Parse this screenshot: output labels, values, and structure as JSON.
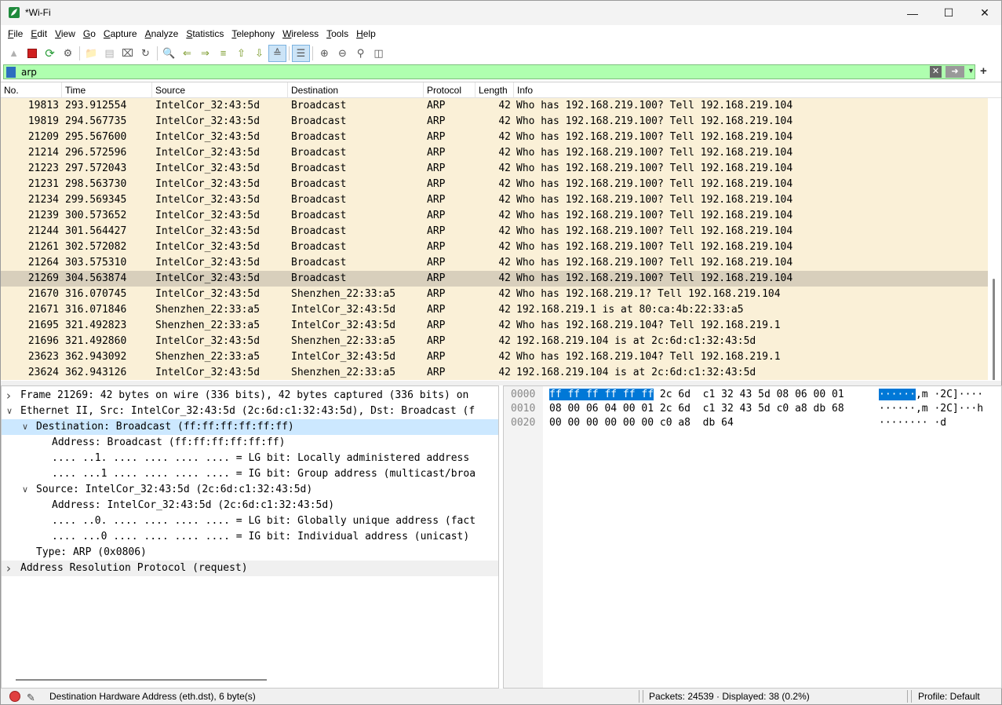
{
  "window": {
    "title": "*Wi-Fi"
  },
  "menu": [
    "File",
    "Edit",
    "View",
    "Go",
    "Capture",
    "Analyze",
    "Statistics",
    "Telephony",
    "Wireless",
    "Tools",
    "Help"
  ],
  "toolbar_icons": [
    "shark-fin-start-icon",
    "stop-capture-icon",
    "restart-capture-icon",
    "capture-options-icon",
    "open-file-icon",
    "save-file-icon",
    "close-file-icon",
    "reload-icon",
    "find-icon",
    "go-back-icon",
    "go-forward-icon",
    "go-to-packet-icon",
    "first-packet-icon",
    "last-packet-icon",
    "autoscroll-icon",
    "colorize-icon",
    "zoom-in-icon",
    "zoom-out-icon",
    "normal-size-icon",
    "resize-columns-icon"
  ],
  "filter": {
    "value": "arp"
  },
  "columns": [
    "No.",
    "Time",
    "Source",
    "Destination",
    "Protocol",
    "Length",
    "Info"
  ],
  "packets": [
    {
      "no": "19813",
      "time": "293.912554",
      "src": "IntelCor_32:43:5d",
      "dst": "Broadcast",
      "proto": "ARP",
      "len": "42",
      "info": "Who has 192.168.219.100? Tell 192.168.219.104"
    },
    {
      "no": "19819",
      "time": "294.567735",
      "src": "IntelCor_32:43:5d",
      "dst": "Broadcast",
      "proto": "ARP",
      "len": "42",
      "info": "Who has 192.168.219.100? Tell 192.168.219.104"
    },
    {
      "no": "21209",
      "time": "295.567600",
      "src": "IntelCor_32:43:5d",
      "dst": "Broadcast",
      "proto": "ARP",
      "len": "42",
      "info": "Who has 192.168.219.100? Tell 192.168.219.104"
    },
    {
      "no": "21214",
      "time": "296.572596",
      "src": "IntelCor_32:43:5d",
      "dst": "Broadcast",
      "proto": "ARP",
      "len": "42",
      "info": "Who has 192.168.219.100? Tell 192.168.219.104"
    },
    {
      "no": "21223",
      "time": "297.572043",
      "src": "IntelCor_32:43:5d",
      "dst": "Broadcast",
      "proto": "ARP",
      "len": "42",
      "info": "Who has 192.168.219.100? Tell 192.168.219.104"
    },
    {
      "no": "21231",
      "time": "298.563730",
      "src": "IntelCor_32:43:5d",
      "dst": "Broadcast",
      "proto": "ARP",
      "len": "42",
      "info": "Who has 192.168.219.100? Tell 192.168.219.104"
    },
    {
      "no": "21234",
      "time": "299.569345",
      "src": "IntelCor_32:43:5d",
      "dst": "Broadcast",
      "proto": "ARP",
      "len": "42",
      "info": "Who has 192.168.219.100? Tell 192.168.219.104"
    },
    {
      "no": "21239",
      "time": "300.573652",
      "src": "IntelCor_32:43:5d",
      "dst": "Broadcast",
      "proto": "ARP",
      "len": "42",
      "info": "Who has 192.168.219.100? Tell 192.168.219.104"
    },
    {
      "no": "21244",
      "time": "301.564427",
      "src": "IntelCor_32:43:5d",
      "dst": "Broadcast",
      "proto": "ARP",
      "len": "42",
      "info": "Who has 192.168.219.100? Tell 192.168.219.104"
    },
    {
      "no": "21261",
      "time": "302.572082",
      "src": "IntelCor_32:43:5d",
      "dst": "Broadcast",
      "proto": "ARP",
      "len": "42",
      "info": "Who has 192.168.219.100? Tell 192.168.219.104"
    },
    {
      "no": "21264",
      "time": "303.575310",
      "src": "IntelCor_32:43:5d",
      "dst": "Broadcast",
      "proto": "ARP",
      "len": "42",
      "info": "Who has 192.168.219.100? Tell 192.168.219.104"
    },
    {
      "no": "21269",
      "time": "304.563874",
      "src": "IntelCor_32:43:5d",
      "dst": "Broadcast",
      "proto": "ARP",
      "len": "42",
      "info": "Who has 192.168.219.100? Tell 192.168.219.104",
      "selected": true
    },
    {
      "no": "21670",
      "time": "316.070745",
      "src": "IntelCor_32:43:5d",
      "dst": "Shenzhen_22:33:a5",
      "proto": "ARP",
      "len": "42",
      "info": "Who has 192.168.219.1? Tell 192.168.219.104"
    },
    {
      "no": "21671",
      "time": "316.071846",
      "src": "Shenzhen_22:33:a5",
      "dst": "IntelCor_32:43:5d",
      "proto": "ARP",
      "len": "42",
      "info": "192.168.219.1 is at 80:ca:4b:22:33:a5"
    },
    {
      "no": "21695",
      "time": "321.492823",
      "src": "Shenzhen_22:33:a5",
      "dst": "IntelCor_32:43:5d",
      "proto": "ARP",
      "len": "42",
      "info": "Who has 192.168.219.104? Tell 192.168.219.1"
    },
    {
      "no": "21696",
      "time": "321.492860",
      "src": "IntelCor_32:43:5d",
      "dst": "Shenzhen_22:33:a5",
      "proto": "ARP",
      "len": "42",
      "info": "192.168.219.104 is at 2c:6d:c1:32:43:5d"
    },
    {
      "no": "23623",
      "time": "362.943092",
      "src": "Shenzhen_22:33:a5",
      "dst": "IntelCor_32:43:5d",
      "proto": "ARP",
      "len": "42",
      "info": "Who has 192.168.219.104? Tell 192.168.219.1"
    },
    {
      "no": "23624",
      "time": "362.943126",
      "src": "IntelCor_32:43:5d",
      "dst": "Shenzhen_22:33:a5",
      "proto": "ARP",
      "len": "42",
      "info": "192.168.219.104 is at 2c:6d:c1:32:43:5d"
    }
  ],
  "details": [
    {
      "arrow": ">",
      "text": "Frame 21269: 42 bytes on wire (336 bits), 42 bytes captured (336 bits) on"
    },
    {
      "arrow": "v",
      "text": "Ethernet II, Src: IntelCor_32:43:5d (2c:6d:c1:32:43:5d), Dst: Broadcast (f"
    },
    {
      "arrow": "v",
      "text": "Destination: Broadcast (ff:ff:ff:ff:ff:ff)",
      "selected": true
    },
    {
      "arrow": "",
      "text": "Address: Broadcast (ff:ff:ff:ff:ff:ff)"
    },
    {
      "arrow": "",
      "text": ".... ..1. .... .... .... .... = LG bit: Locally administered address"
    },
    {
      "arrow": "",
      "text": ".... ...1 .... .... .... .... = IG bit: Group address (multicast/broa"
    },
    {
      "arrow": "v",
      "text": "Source: IntelCor_32:43:5d (2c:6d:c1:32:43:5d)"
    },
    {
      "arrow": "",
      "text": "Address: IntelCor_32:43:5d (2c:6d:c1:32:43:5d)"
    },
    {
      "arrow": "",
      "text": ".... ..0. .... .... .... .... = LG bit: Globally unique address (fact"
    },
    {
      "arrow": "",
      "text": ".... ...0 .... .... .... .... = IG bit: Individual address (unicast)"
    },
    {
      "arrow": "",
      "text": "Type: ARP (0x0806)"
    },
    {
      "arrow": ">",
      "text": "Address Resolution Protocol (request)",
      "grey": true
    }
  ],
  "bytes": [
    {
      "offset": "0000",
      "hex_hl": "ff ff ff ff ff ff",
      "hex_rest": " 2c 6d  c1 32 43 5d 08 06 00 01",
      "ascii_hl": "······",
      "ascii_rest": ",m ·2C]····"
    },
    {
      "offset": "0010",
      "hex_hl": "",
      "hex_rest": "08 00 06 04 00 01 2c 6d  c1 32 43 5d c0 a8 db 68",
      "ascii_hl": "",
      "ascii_rest": "······,m ·2C]···h"
    },
    {
      "offset": "0020",
      "hex_hl": "",
      "hex_rest": "00 00 00 00 00 00 c0 a8  db 64",
      "ascii_hl": "",
      "ascii_rest": "········ ·d"
    }
  ],
  "status": {
    "field": "Destination Hardware Address (eth.dst), 6 byte(s)",
    "packets": "Packets: 24539 · Displayed: 38 (0.2%)",
    "profile": "Profile: Default"
  },
  "colors": {
    "row_bg": "#faf0d7",
    "row_selected": "#d8cfbc",
    "filter_bg": "#afffaf",
    "hex_highlight": "#0078d7",
    "detail_selected": "#cce8ff"
  }
}
